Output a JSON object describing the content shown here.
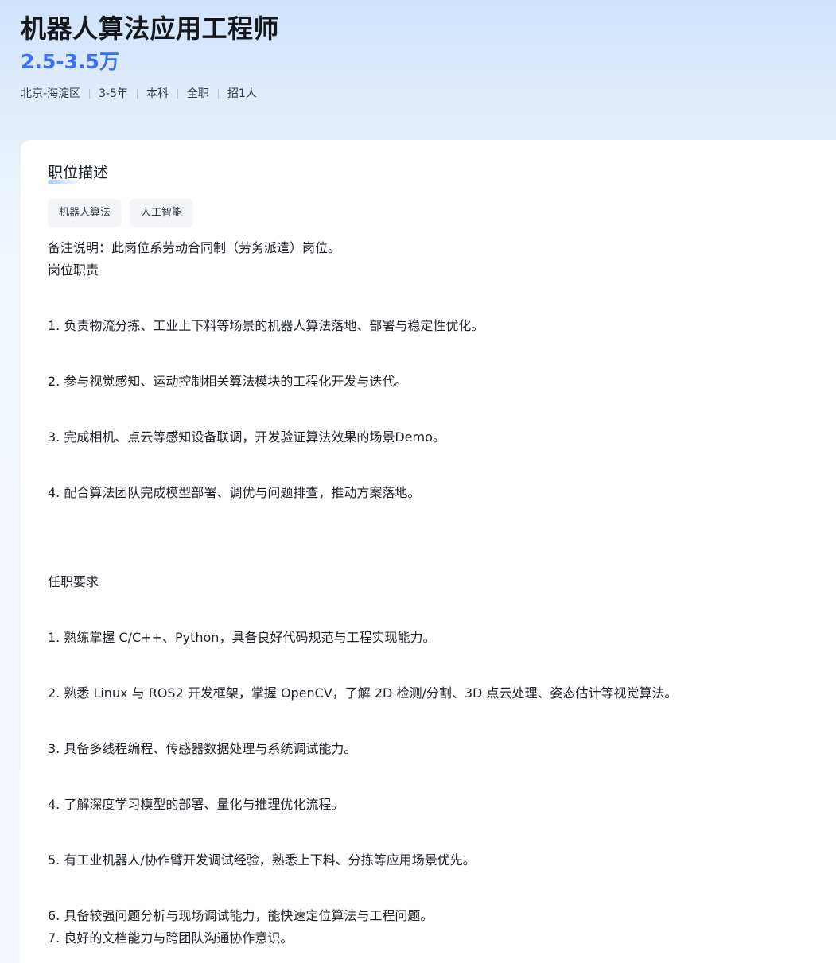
{
  "header": {
    "title": "机器人算法应用工程师",
    "salary": "2.5-3.5万",
    "meta": [
      "北京-海淀区",
      "3-5年",
      "本科",
      "全职",
      "招1人"
    ]
  },
  "section": {
    "title": "职位描述",
    "tags": [
      "机器人算法",
      "人工智能"
    ]
  },
  "description": {
    "note": "备注说明：此岗位系劳动合同制（劳务派遣）岗位。",
    "duties_title": "岗位职责",
    "duties": [
      "1. 负责物流分拣、工业上下料等场景的机器人算法落地、部署与稳定性优化。",
      "2. 参与视觉感知、运动控制相关算法模块的工程化开发与迭代。",
      "3. 完成相机、点云等感知设备联调，开发验证算法效果的场景Demo。",
      "4. 配合算法团队完成模型部署、调优与问题排查，推动方案落地。"
    ],
    "requirements_title": "任职要求",
    "requirements": [
      "1. 熟练掌握 C/C++、Python，具备良好代码规范与工程实现能力。",
      "2. 熟悉 Linux 与 ROS2 开发框架，掌握 OpenCV，了解 2D 检测/分割、3D 点云处理、姿态估计等视觉算法。",
      "3. 具备多线程编程、传感器数据处理与系统调试能力。",
      "4. 了解深度学习模型的部署、量化与推理优化流程。",
      "5. 有工业机器人/协作臂开发调试经验，熟悉上下料、分拣等应用场景优先。",
      "6. 具备较强问题分析与现场调试能力，能快速定位算法与工程问题。",
      "7. 良好的文档能力与跨团队沟通协作意识。"
    ]
  },
  "colors": {
    "salary": "#3b6ff5",
    "title": "#15171c",
    "tag_bg": "#f3f5f8"
  }
}
